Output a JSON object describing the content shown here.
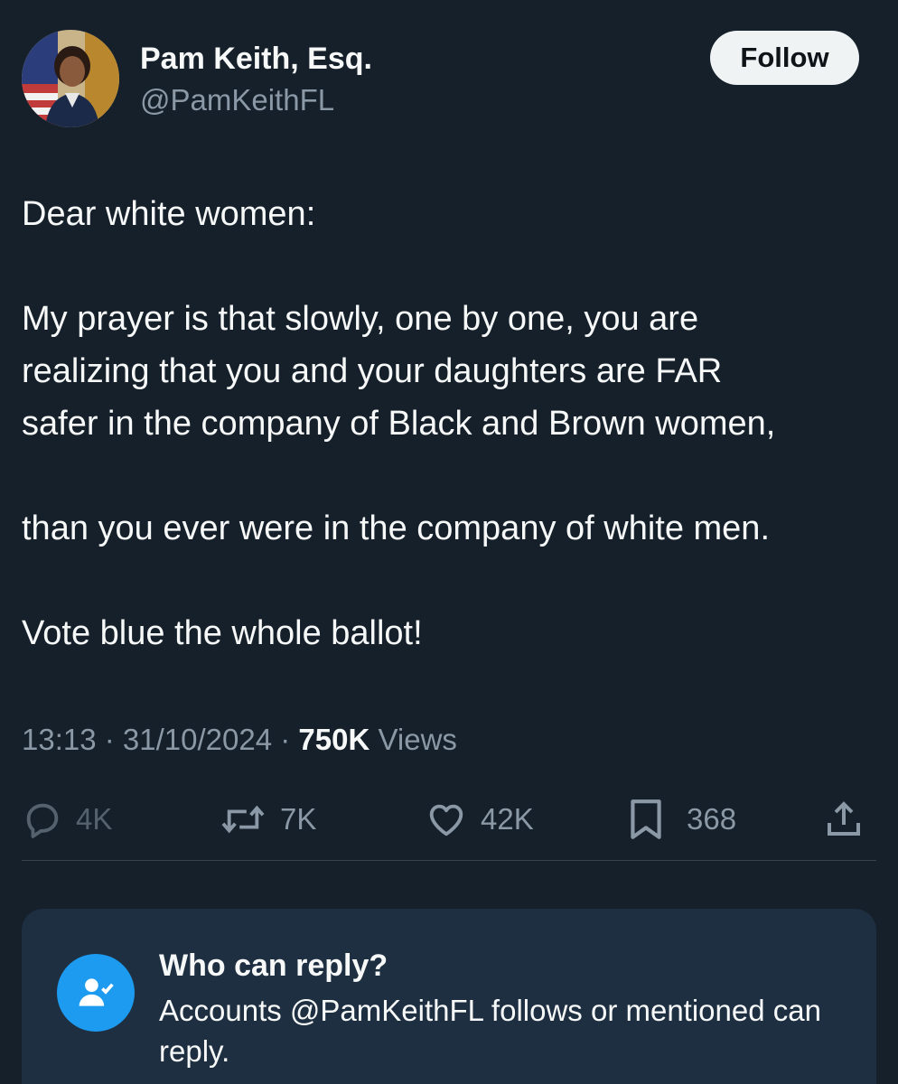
{
  "author": {
    "name": "Pam Keith, Esq.",
    "handle": "@PamKeithFL"
  },
  "follow_label": "Follow",
  "tweet": {
    "lines": [
      "Dear white women:",
      "My prayer is that slowly, one by one, you are",
      "realizing that you and your daughters are FAR",
      "safer in the company of Black and Brown women,",
      "than you ever were in the company of white men.",
      "Vote blue the whole ballot!"
    ]
  },
  "meta": {
    "time": "13:13",
    "date": "31/10/2024",
    "separator": " · ",
    "views_count": "750K",
    "views_label": " Views"
  },
  "actions": {
    "replies": "4K",
    "reposts": "7K",
    "likes": "42K",
    "bookmarks": "368"
  },
  "reply_settings": {
    "title": "Who can reply?",
    "description": "Accounts @PamKeithFL follows or mentioned can reply."
  },
  "colors": {
    "background": "#15202b",
    "secondary_text": "#8b98a5",
    "accent": "#1d9bf0",
    "reply_box": "#1e2f41"
  },
  "icons": [
    "reply-icon",
    "repost-icon",
    "like-icon",
    "bookmark-icon",
    "share-icon",
    "person-check-icon"
  ]
}
